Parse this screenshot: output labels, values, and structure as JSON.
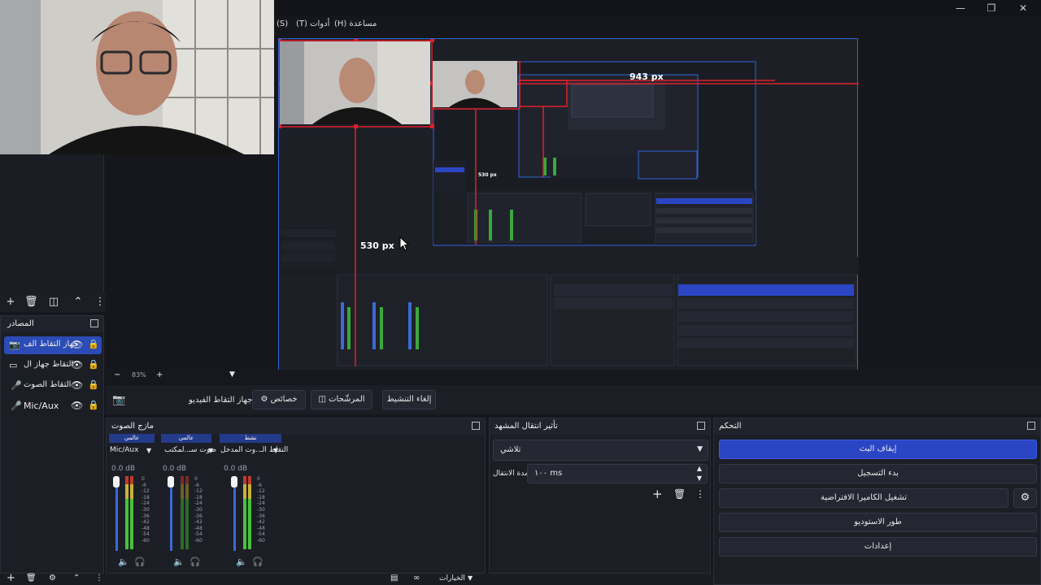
{
  "menu": {
    "file": "(S)",
    "tools": "(T) أدوات",
    "help": "(H) مساعدة"
  },
  "preview": {
    "measure_top": "943 px",
    "measure_left": "530 px",
    "measure_inner": "530 px",
    "zoom": "83%"
  },
  "toolbar": {
    "source_label": "جهاز التقاط الفيديو",
    "properties": "خصائص",
    "filters": "المرشّحات",
    "deactivate": "إلغاء التنشيط"
  },
  "sources": {
    "title": "المصادر",
    "items": [
      {
        "label": "جهاز التقاط الف",
        "icon": "camera-icon",
        "selected": true
      },
      {
        "label": "التقاط جهاز ال",
        "icon": "monitor-icon",
        "selected": false
      },
      {
        "label": "التقاط الصوت",
        "icon": "mic-icon",
        "selected": false
      },
      {
        "label": "Mic/Aux",
        "icon": "mic-icon",
        "selected": false
      }
    ]
  },
  "mixer": {
    "title": "مازج الصوت",
    "channels": [
      {
        "badge": "عالمي",
        "name": "Mic/Aux",
        "db": "0.0 dB"
      },
      {
        "badge": "عالمي",
        "name": "صوت سـ..لمكتب",
        "db": "0.0 dB"
      },
      {
        "badge": "نشط",
        "name": "التقاط الـ..وت المدخل",
        "db": "0.0 dB"
      }
    ],
    "ticks": [
      "0",
      "-6",
      "-12",
      "-18",
      "-24",
      "-30",
      "-36",
      "-42",
      "-48",
      "-54",
      "-60"
    ]
  },
  "transitions": {
    "title": "تأثير انتقال المشهد",
    "selected": "تلاشي",
    "duration_label": "مدة الانتقال",
    "duration_value": "١٠٠ ms"
  },
  "controls": {
    "title": "التحكم",
    "stop_stream": "إيقاف البث",
    "start_record": "بدء التسجيل",
    "virtual_cam": "تشغيل الكاميرا الافتراضية",
    "studio_mode": "طور الاستوديو",
    "settings": "إعدادات"
  },
  "bottom": {
    "scene_label": "الخيارات"
  },
  "colors": {
    "accent": "#2a46c4",
    "red": "#e0202a",
    "panel": "#1c1e26",
    "background": "#15171d"
  }
}
